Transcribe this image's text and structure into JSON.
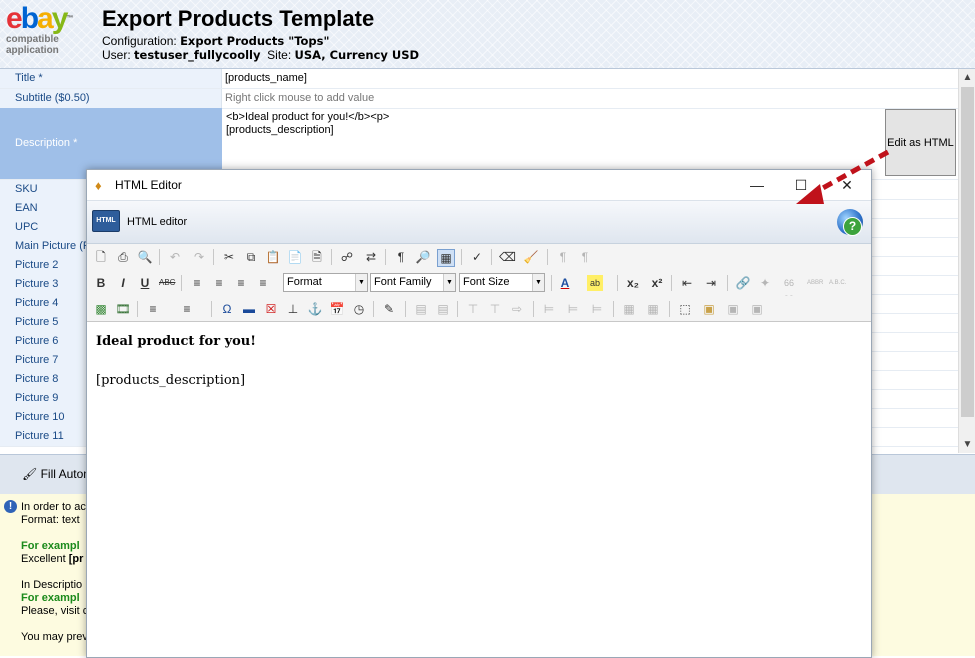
{
  "header": {
    "logo": {
      "ebay": [
        "e",
        "b",
        "a",
        "y"
      ],
      "tm": "™",
      "line1": "compatible",
      "line2": "application"
    },
    "title": "Export Products Template",
    "config_label": "Configuration:",
    "config_value": "Export Products \"Tops\"",
    "user_label": "User:",
    "user_value": "testuser_fullycoolly",
    "site_label": "Site:",
    "site_value": "USA, Currency USD"
  },
  "grid": {
    "title_label": "Title *",
    "title_value": "[products_name]",
    "subtitle_label": "Subtitle ($0.50)",
    "subtitle_value": "Right click mouse to add value",
    "description_label": "Description *",
    "description_line1": "<b>Ideal product for you!</b><p>",
    "description_line2": "[products_description]",
    "edit_html_button": "Edit as HTML",
    "rows": [
      "SKU",
      "EAN",
      "UPC",
      "Main Picture (F",
      "Picture 2",
      "Picture 3",
      "Picture 4",
      "Picture 5",
      "Picture 6",
      "Picture 7",
      "Picture 8",
      "Picture 9",
      "Picture 10",
      "Picture 11"
    ]
  },
  "bottom": {
    "fill_label": "Fill Autom"
  },
  "info": {
    "line1": "In order to ac",
    "line2": "Format: text",
    "line3": "For exampl",
    "line4a": "Excellent ",
    "line4b": "[pr",
    "line5": "In Descriptio",
    "line6": "For exampl",
    "line7": "Please, visit c",
    "line8": "You may prev"
  },
  "editor": {
    "window_title": "HTML Editor",
    "banner_badge": "HTML",
    "banner_text": "HTML editor",
    "format_select": "Format",
    "font_family_select": "Font Family",
    "font_size_select": "Font Size",
    "content_bold": "Ideal product for you!",
    "content_text": "[products_description]"
  },
  "colors": {
    "accent": "#9fbfe8",
    "label_text": "#1a4a86",
    "arrow": "#c0121b"
  }
}
